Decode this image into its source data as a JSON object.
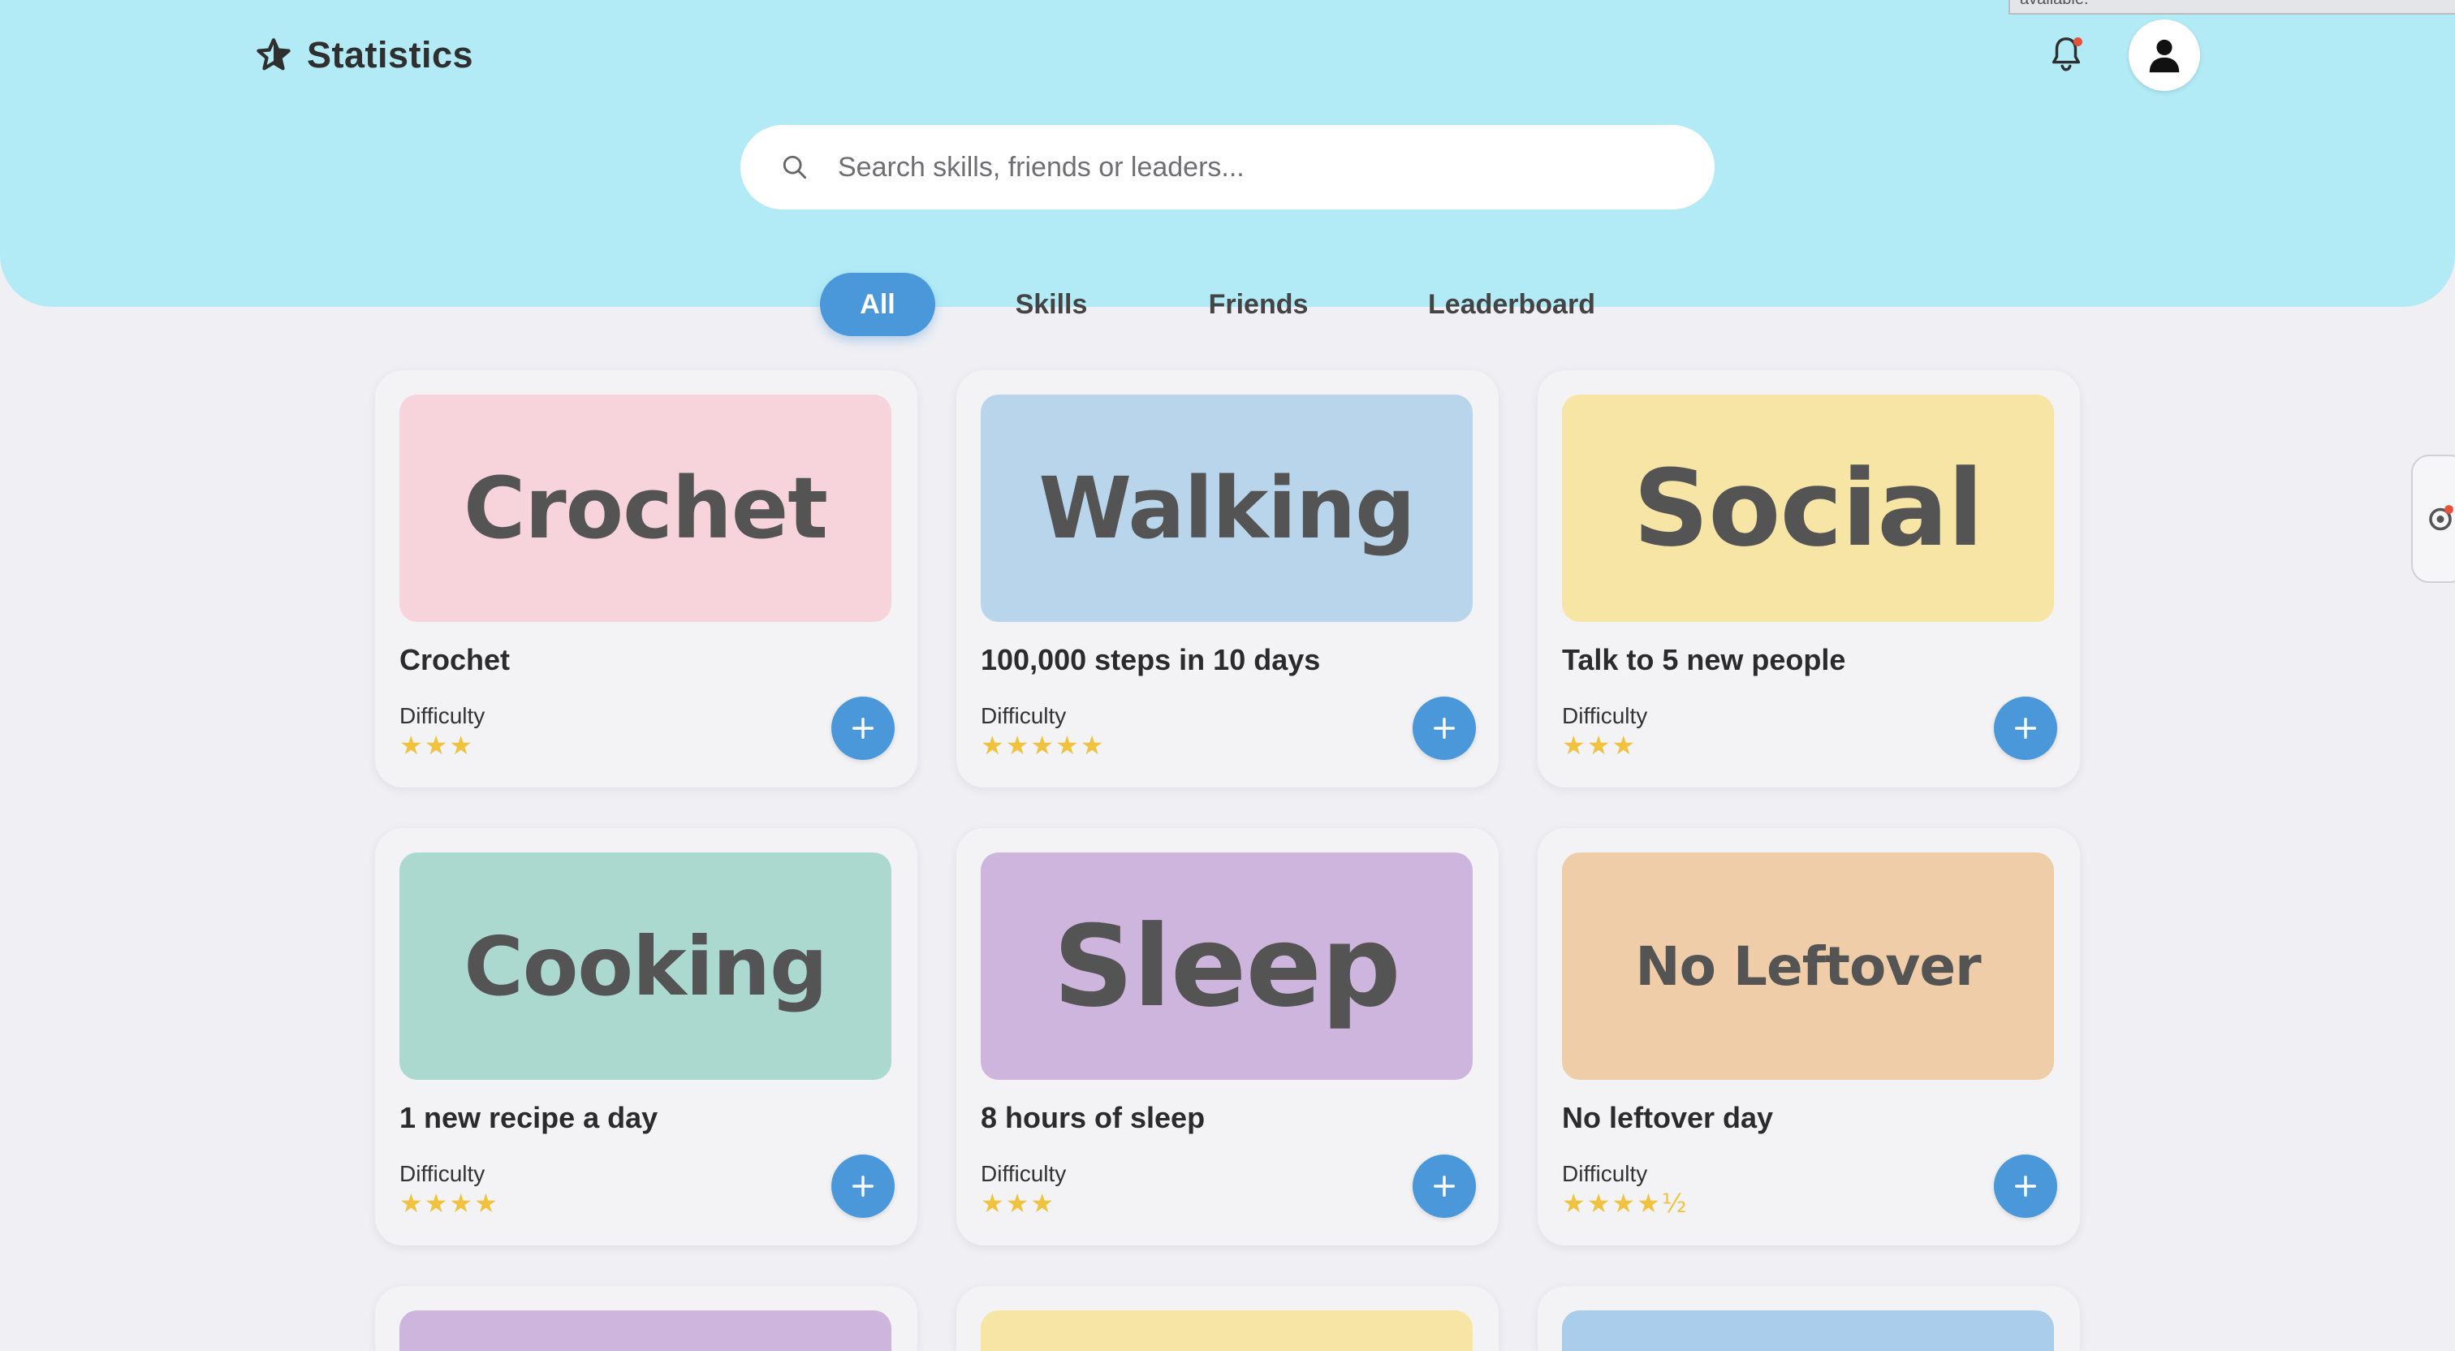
{
  "header": {
    "title": "Statistics",
    "notification_indicator": true,
    "background_color": "#b2ebf6"
  },
  "top_strip_text": "available.",
  "search": {
    "placeholder": "Search skills, friends or leaders...",
    "value": ""
  },
  "tabs": [
    {
      "label": "All",
      "active": true
    },
    {
      "label": "Skills",
      "active": false
    },
    {
      "label": "Friends",
      "active": false
    },
    {
      "label": "Leaderboard",
      "active": false
    }
  ],
  "accent_color": "#4a98d9",
  "star_color": "#f0c23e",
  "cards": [
    {
      "banner": "Crochet",
      "banner_color": "#f7d3dc",
      "title": "Crochet",
      "difficulty_label": "Difficulty",
      "stars": "★★★",
      "rating": 3
    },
    {
      "banner": "Walking",
      "banner_color": "#b8d5ec",
      "title": "100,000 steps in 10 days",
      "difficulty_label": "Difficulty",
      "stars": "★★★★★",
      "rating": 5
    },
    {
      "banner": "Social",
      "banner_color": "#f6e5a5",
      "title": "Talk to 5 new people",
      "difficulty_label": "Difficulty",
      "stars": "★★★",
      "rating": 3
    },
    {
      "banner": "Cooking",
      "banner_color": "#acd9cf",
      "title": "1 new recipe a day",
      "difficulty_label": "Difficulty",
      "stars": "★★★★",
      "rating": 4
    },
    {
      "banner": "Sleep",
      "banner_color": "#cdb5de",
      "title": "8 hours of sleep",
      "difficulty_label": "Difficulty",
      "stars": "★★★",
      "rating": 3
    },
    {
      "banner": "No Leftover",
      "banner_color": "#efcda9",
      "title": "No leftover day",
      "difficulty_label": "Difficulty",
      "stars": "★★★★½",
      "rating": 4.5
    }
  ],
  "partial_cards": [
    {
      "banner_color": "#cdb5de"
    },
    {
      "banner_color": "#f6e5a5"
    },
    {
      "banner_color": "#a9cdea"
    }
  ],
  "icons": {
    "brand": "star-icon",
    "notifications": "bell-icon",
    "profile": "user-icon",
    "search": "search-icon",
    "add": "plus-icon",
    "side_widget": "extension-icon"
  }
}
